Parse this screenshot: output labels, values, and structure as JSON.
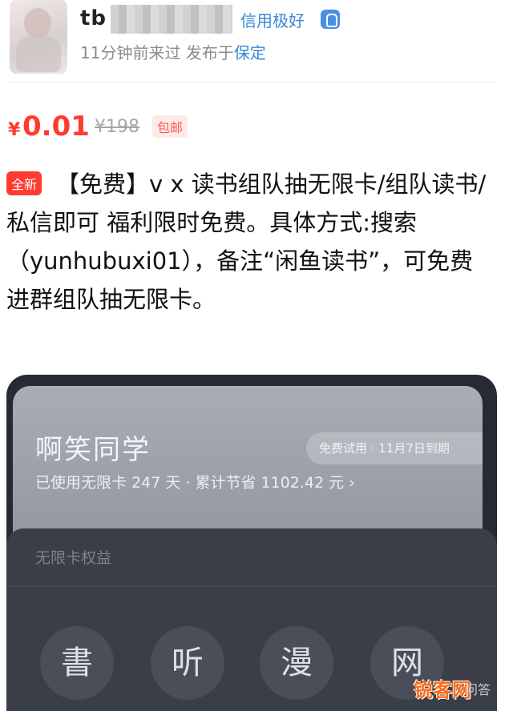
{
  "header": {
    "user_name": "tb",
    "credit_label": "信用极好",
    "meta_prefix": "11分钟前来过  发布于",
    "meta_location": "保定"
  },
  "price": {
    "currency": "¥",
    "current": "0.01",
    "original": "¥198",
    "shipping_tag": "包邮"
  },
  "listing": {
    "condition_badge": "全新",
    "description": "【免费】v x 读书组队抽无限卡/组队读书/私信即可 福利限时免费。具体方式:搜索（yunhubuxi01），备注“闲鱼读书”，可免费进群组队抽无限卡。"
  },
  "screenshot_card": {
    "title": "啊笑同学",
    "subtitle": "已使用无限卡 247 天 · 累计节省 1102.42 元 ›",
    "trial_label": "免费试用 · 11月7日到期",
    "panel_title": "无限卡权益",
    "benefits": [
      "書",
      "听",
      "漫",
      "网"
    ]
  },
  "watermark": {
    "logo_text": "锐客网",
    "suffix_text": "问答"
  },
  "colors": {
    "price_red": "#ff3b30",
    "link_blue": "#3a86d8"
  }
}
